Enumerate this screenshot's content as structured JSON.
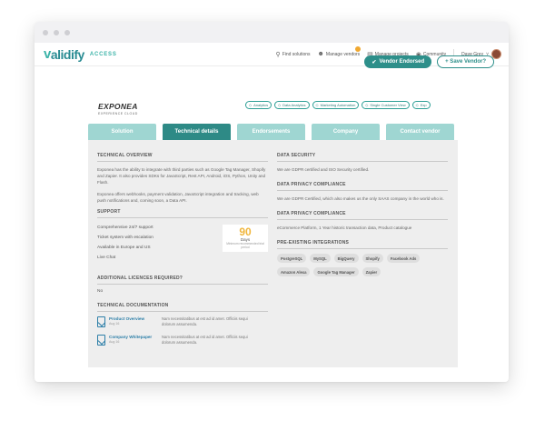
{
  "app": {
    "logo_text": "alidify",
    "logo_prefix": "v",
    "logo_sub": "ACCESS"
  },
  "nav": {
    "items": [
      {
        "label": "Find solutions",
        "icon": "search-icon"
      },
      {
        "label": "Manage vendors",
        "icon": "person-icon"
      },
      {
        "label": "Manage projects",
        "icon": "folder-icon"
      },
      {
        "label": "Community",
        "icon": "globe-icon"
      }
    ],
    "user_name": "Dave Grey"
  },
  "actions": {
    "endorsed_label": "Vendor Endorsed",
    "save_label": "+ Save Vendor?"
  },
  "vendor": {
    "name": "EXPONEA",
    "subtitle": "EXPERIENCE CLOUD",
    "tags": [
      "Analytics",
      "Data Analytics",
      "Marketing Automation",
      "Single Customer View",
      "Exp"
    ]
  },
  "tabs": [
    "Solution",
    "Technical details",
    "Endorsements",
    "Company",
    "Contact vendor"
  ],
  "active_tab": "Technical details",
  "left": {
    "overview_title": "TECHNICAL OVERVIEW",
    "overview_p1": "Exponea has the ability to integrate with third parties such as Google Tag Manager, Shopify and Zapier. It also provides SDKs for JavaScript, Rest API, Android, iOS, Python, Unity and Flash.",
    "overview_p2": "Exponea offers webhooks, payment validation, JavaScript integration and tracking, web push notifications and, coming soon, a Data API.",
    "support_title": "SUPPORT",
    "support_items": [
      "Comprehensive 24/7 support",
      "Ticket system with escalation",
      "Available in Europe and US",
      "Live Chat"
    ],
    "days_number": "90",
    "days_label": "Days",
    "days_note": "Minimum recommended trial period",
    "licences_title": "ADDITIONAL LICENCES REQUIRED?",
    "licences_value": "No",
    "docs_title": "TECHNICAL DOCUMENTATION",
    "docs": [
      {
        "name": "Product Overview",
        "date": "Aug 16",
        "desc": "Nam necessitatibus at est ad id amet. Officiis sequi dolorum assumenda."
      },
      {
        "name": "Company Whitepaper",
        "date": "Aug 16",
        "desc": "Nam necessitatibus at est ad id amet. Officiis sequi dolorum assumenda."
      }
    ]
  },
  "right": {
    "security_title": "DATA SECURITY",
    "security_text": "We are GDPR certified and ISO Security certified.",
    "privacy_title": "DATA PRIVACY COMPLIANCE",
    "privacy_text": "We are GDPR Certified, which also makes us the only SAAS company in the world who is.",
    "privacy2_title": "DATA PRIVACY COMPLIANCE",
    "privacy2_text": "eCommerce Platform, 1 Year historic transaction data, Product catalogue",
    "integrations_title": "PRE-EXISTING INTEGRATIONS",
    "integrations": [
      "PostgreSQL",
      "MySQL",
      "BigQuery",
      "Shopify",
      "Facebook Ads",
      "Amazon Alexa",
      "Google Tag Manager",
      "Zapier"
    ]
  },
  "colors": {
    "accent": "#2d8f8a",
    "tab_inactive": "#9fd6d2",
    "days": "#f0b63c",
    "doc_link": "#2d7fa8"
  }
}
